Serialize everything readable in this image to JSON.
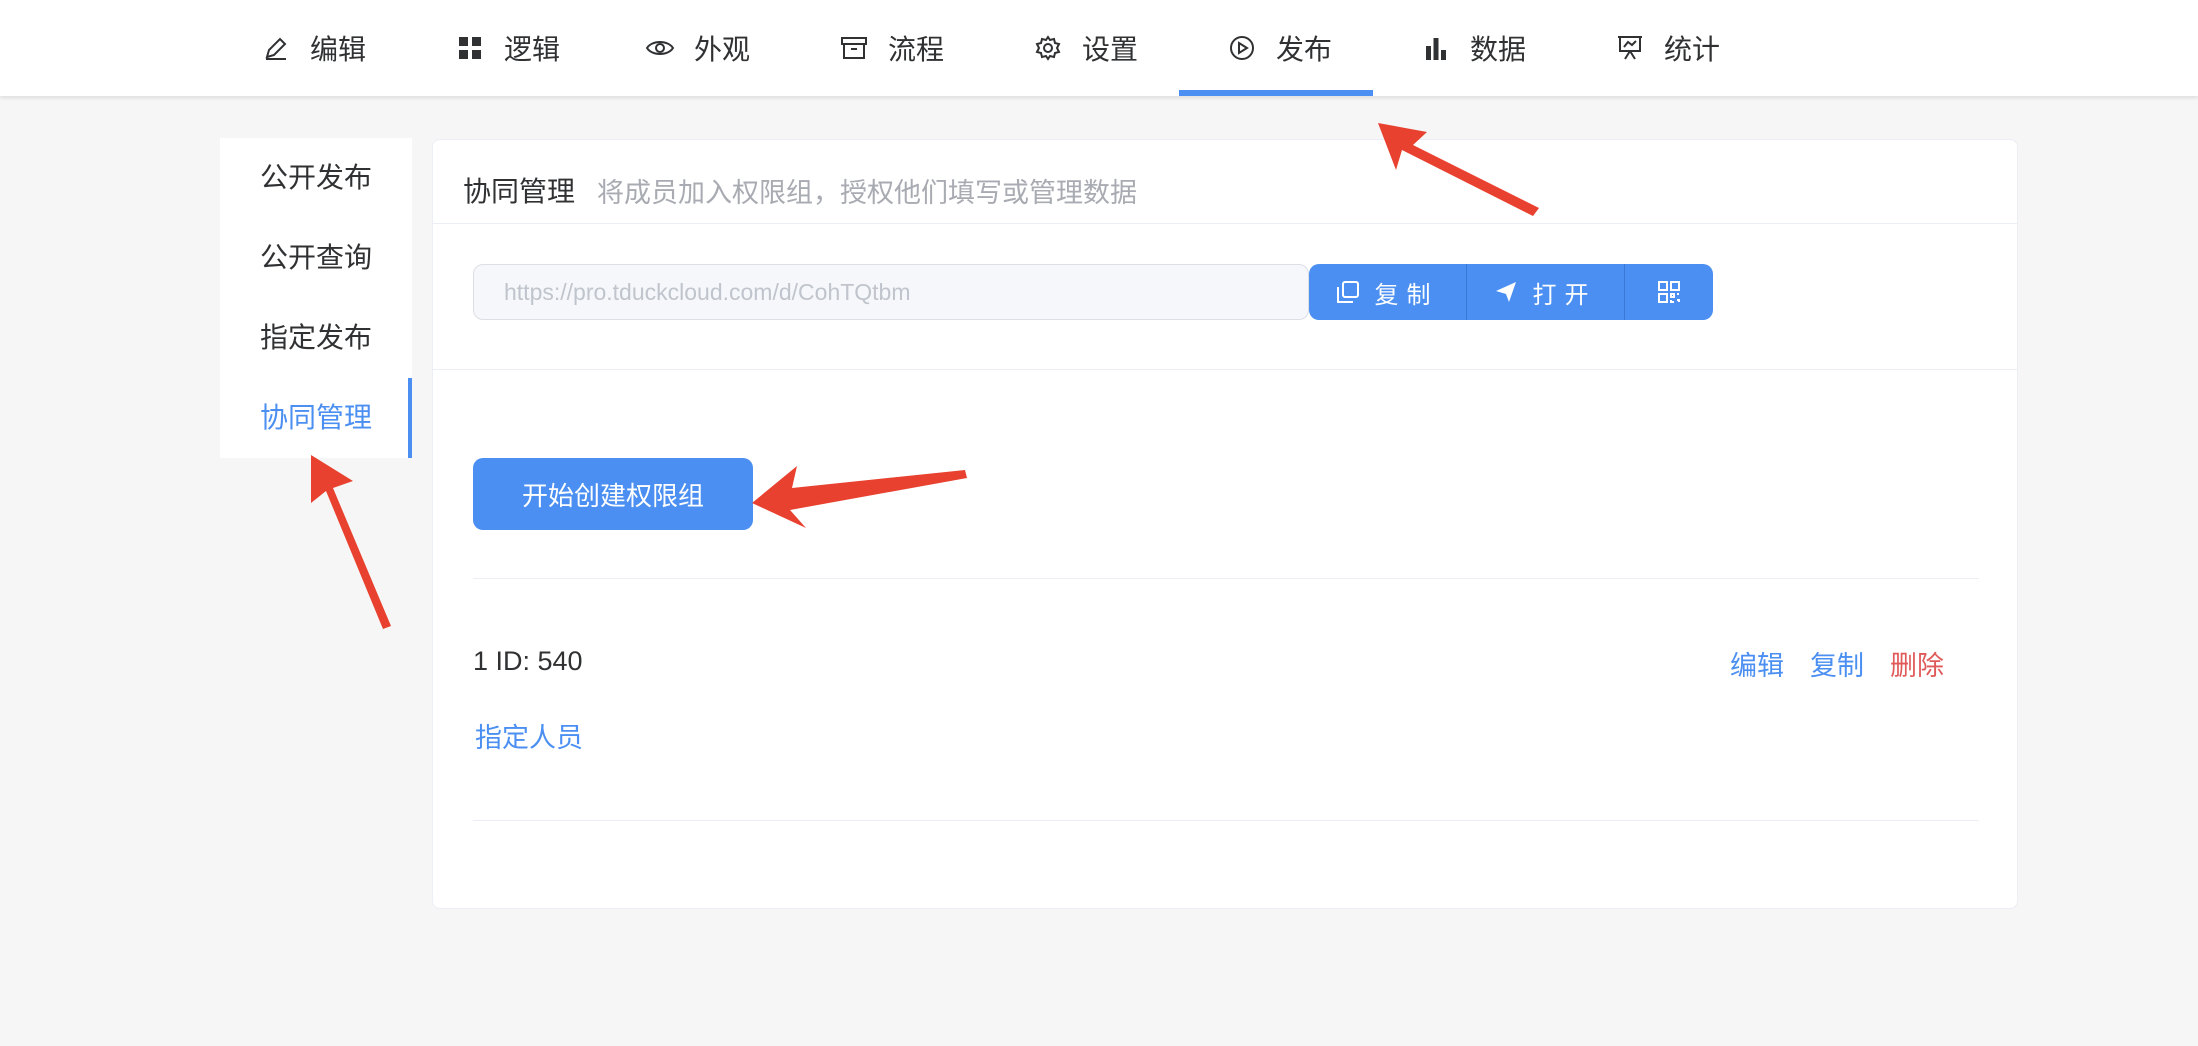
{
  "nav": {
    "items": [
      {
        "label": "编辑",
        "icon": "pencil-icon"
      },
      {
        "label": "逻辑",
        "icon": "grid-icon"
      },
      {
        "label": "外观",
        "icon": "eye-icon"
      },
      {
        "label": "流程",
        "icon": "archive-icon"
      },
      {
        "label": "设置",
        "icon": "gear-icon"
      },
      {
        "label": "发布",
        "icon": "play-circle-icon",
        "active": true
      },
      {
        "label": "数据",
        "icon": "bar-chart-icon"
      },
      {
        "label": "统计",
        "icon": "presentation-icon"
      }
    ]
  },
  "sidebar": {
    "items": [
      {
        "label": "公开发布"
      },
      {
        "label": "公开查询"
      },
      {
        "label": "指定发布"
      },
      {
        "label": "协同管理",
        "active": true
      }
    ]
  },
  "main": {
    "title": "协同管理",
    "subtitle": "将成员加入权限组，授权他们填写或管理数据",
    "url_placeholder": "https://pro.tduckcloud.com/d/CohTQtbm",
    "copy_label": "复制",
    "open_label": "打开",
    "create_button": "开始创建权限组",
    "group": {
      "id_text": "1 ID: 540",
      "edit": "编辑",
      "copy": "复制",
      "delete": "删除",
      "assign": "指定人员"
    }
  },
  "colors": {
    "accent": "#4a8ff1",
    "danger": "#e05a5a",
    "annotation": "#e8412f"
  }
}
